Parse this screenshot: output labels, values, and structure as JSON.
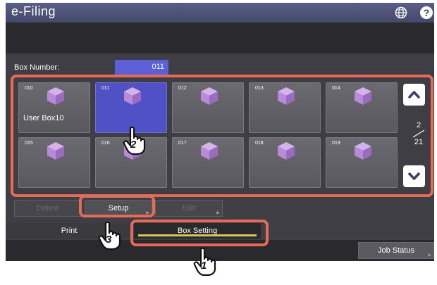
{
  "app": {
    "title": "e-Filing"
  },
  "header": {
    "globe_icon": "globe-icon",
    "help_icon": "help-icon",
    "help_glyph": "?"
  },
  "box_number": {
    "label": "Box Number:",
    "value": "011"
  },
  "boxes": [
    {
      "number": "010",
      "name": "User Box10",
      "selected": false
    },
    {
      "number": "011",
      "name": "",
      "selected": true
    },
    {
      "number": "012",
      "name": "",
      "selected": false
    },
    {
      "number": "013",
      "name": "",
      "selected": false
    },
    {
      "number": "014",
      "name": "",
      "selected": false
    },
    {
      "number": "015",
      "name": "",
      "selected": false
    },
    {
      "number": "016",
      "name": "",
      "selected": false
    },
    {
      "number": "017",
      "name": "",
      "selected": false
    },
    {
      "number": "018",
      "name": "",
      "selected": false
    },
    {
      "number": "019",
      "name": "",
      "selected": false
    }
  ],
  "pagination": {
    "current": "2",
    "total": "21"
  },
  "actions": {
    "delete": "Delete",
    "setup": "Setup",
    "edit": "Edit"
  },
  "tabs": {
    "print": "Print",
    "box_setting": "Box Setting"
  },
  "footer": {
    "job_status": "Job Status"
  },
  "steps": [
    "1",
    "2",
    "3"
  ],
  "colors": {
    "highlight": "#e56b57",
    "selected_tile": "#4f51c4",
    "tab_underline": "#d7c84a",
    "cube": "#b98ad8"
  }
}
